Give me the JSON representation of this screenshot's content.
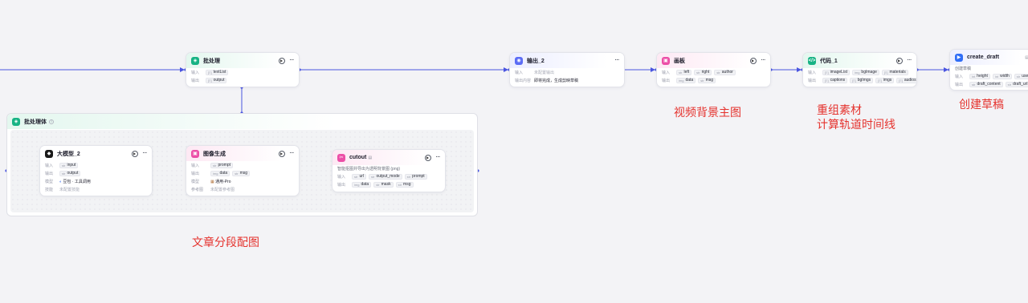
{
  "nodes": {
    "batch": {
      "title": "批处理",
      "input_label": "输入",
      "input_tags": [
        "textList"
      ],
      "output_label": "输出",
      "output_tags": [
        "output"
      ]
    },
    "output2": {
      "title": "输出_2",
      "input_label": "输入",
      "input_hint": "未配置输出",
      "content_label": "输出内容",
      "content_text": "即将完成，生成剪映草稿"
    },
    "canvas": {
      "title": "画板",
      "input_label": "输入",
      "input_tags": [
        "left",
        "right",
        "author"
      ],
      "output_label": "输出",
      "output_tags": [
        "data",
        "msg"
      ]
    },
    "code1": {
      "title": "代码_1",
      "input_label": "输入",
      "input_tags": [
        "imageList",
        "bgImage",
        "materials"
      ],
      "output_label": "输出",
      "output_tags": [
        "captions",
        "bgImgs",
        "imgs",
        "audios"
      ]
    },
    "create_draft": {
      "title": "create_draft",
      "desc": "创建草稿",
      "input_label": "输入",
      "input_tags": [
        "height",
        "width",
        "user_id"
      ],
      "output_label": "输出",
      "output_tags": [
        "draft_content",
        "draft_url"
      ]
    },
    "llm2": {
      "title": "大模型_2",
      "input_label": "输入",
      "input_tags": [
        "input"
      ],
      "output_label": "输出",
      "output_tags": [
        "output"
      ],
      "model_label": "模型",
      "model_value": "豆包 · 工具调用",
      "skill_label": "技能",
      "skill_hint": "未配置技能"
    },
    "image_gen": {
      "title": "图像生成",
      "input_label": "输入",
      "input_tags": [
        "prompt"
      ],
      "output_label": "输出",
      "output_tags": [
        "data",
        "msg"
      ],
      "model_label": "模型",
      "model_value": "通用-Pro",
      "ref_label": "参考图",
      "ref_hint": "未配置参考图"
    },
    "cutout": {
      "title": "cutout",
      "desc": "智能抠图并导出为透明背景图 (png)",
      "input_label": "输入",
      "input_tags": [
        "url",
        "output_mode",
        "prompt"
      ],
      "output_label": "输出",
      "output_tags": [
        "data",
        "mask",
        "msg"
      ]
    }
  },
  "container": {
    "title": "批处理体"
  },
  "annotations": {
    "video_bg": "视频背景主图",
    "recombine_1": "重组素材",
    "recombine_2": "计算轨道时间线",
    "create": "创建草稿",
    "article": "文章分段配图"
  },
  "colors": {
    "edge": "#4a55e0",
    "annotation": "#e5322d",
    "green_icon": "#17b384",
    "blue_icon": "#5b6cf5",
    "pink_icon": "#ec4ea7"
  }
}
